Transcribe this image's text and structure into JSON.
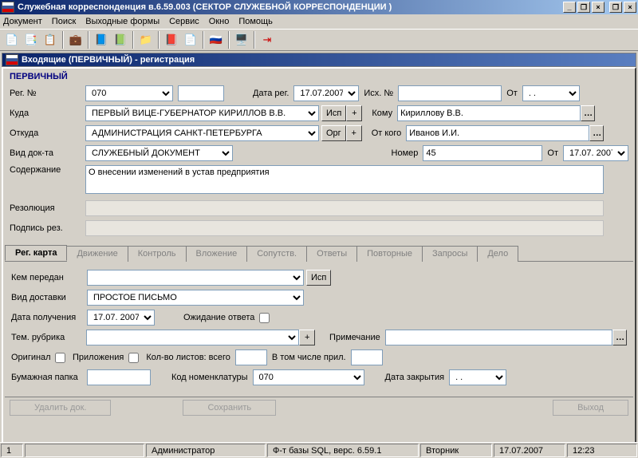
{
  "window": {
    "title": "Служебная корреспонденция в.6.59.003 (СЕКТОР СЛУЖЕБНОЙ КОРРЕСПОНДЕНЦИИ )",
    "subtitle": "Входящие (ПЕРВИЧНЫЙ) - регистрация"
  },
  "menu": [
    "Документ",
    "Поиск",
    "Выходные формы",
    "Сервис",
    "Окно",
    "Помощь"
  ],
  "primary": "ПЕРВИЧНЫЙ",
  "fields": {
    "reg_no_label": "Рег. №",
    "reg_no": "070",
    "reg_date_label": "Дата рег.",
    "reg_date": "17.07.2007",
    "out_no_label": "Исх. №",
    "out_no": "",
    "from_date_label1": "От",
    "from_date1": " . . ",
    "where_label": "Куда",
    "where": "ПЕРВЫЙ ВИЦЕ-ГУБЕРНАТОР КИРИЛЛОВ В.В.",
    "isp_btn": "Исп",
    "to_whom_label": "Кому",
    "to_whom": "Кириллову В.В.",
    "from_label": "Откуда",
    "from": "АДМИНИСТРАЦИЯ САНКТ-ПЕТЕРБУРГА",
    "org_btn": "Орг",
    "from_whom_label": "От кого",
    "from_whom": "Иванов И.И.",
    "doc_type_label": "Вид док-та",
    "doc_type": "СЛУЖЕБНЫЙ ДОКУМЕНТ",
    "number_label": "Номер",
    "number": "45",
    "ext_date_label": "От",
    "ext_date": "17.07. 2007",
    "content_label": "Содержание",
    "content": "О внесении изменений в устав предприятия",
    "resolution_label": "Резолюция",
    "sign_label": "Подпись рез."
  },
  "tabs": [
    "Рег. карта",
    "Движение",
    "Контроль",
    "Вложение",
    "Сопутств.",
    "Ответы",
    "Повторные",
    "Запросы",
    "Дело"
  ],
  "card": {
    "by_whom_label": "Кем передан",
    "isp_btn2": "Исп",
    "delivery_label": "Вид доставки",
    "delivery": "ПРОСТОЕ ПИСЬМО",
    "recv_date_label": "Дата получения",
    "recv_date": "17.07. 2007",
    "wait_label": "Ожидание ответа",
    "topic_label": "Тем. рубрика",
    "note_label": "Примечание",
    "original_label": "Оригинал",
    "attach_label": "Приложения",
    "sheets_label": "Кол-во листов: всего",
    "incl_label": "В том числе прил.",
    "folder_label": "Бумажная папка",
    "nomen_label": "Код номенклатуры",
    "nomen": "070",
    "close_date_label": "Дата закрытия",
    "close_date": " . . "
  },
  "bottom": {
    "del": "Удалить док.",
    "save": "Сохранить",
    "exit": "Выход"
  },
  "status": {
    "s1": "1",
    "s2": "Администратор",
    "s3": "Ф-т базы SQL, верс. 6.59.1",
    "s4": "Вторник",
    "s5": "17.07.2007",
    "s6": "12:23"
  }
}
